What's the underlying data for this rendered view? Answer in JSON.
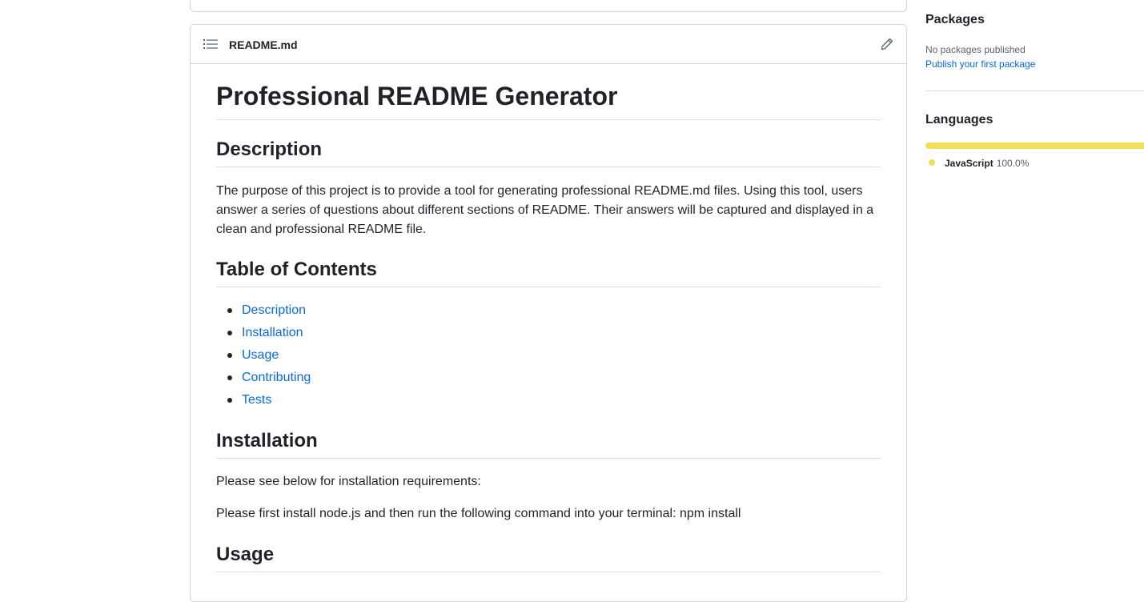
{
  "readme": {
    "filename": "README.md",
    "title": "Professional README Generator",
    "sections": {
      "description": {
        "heading": "Description",
        "body": "The purpose of this project is to provide a tool for generating professional README.md files. Using this tool, users answer a series of questions about different sections of README. Their answers will be captured and displayed in a clean and professional README file."
      },
      "toc": {
        "heading": "Table of Contents",
        "items": [
          "Description",
          "Installation",
          "Usage",
          "Contributing",
          "Tests"
        ]
      },
      "installation": {
        "heading": "Installation",
        "para1": "Please see below for installation requirements:",
        "para2": "Please first install node.js and then run the following command into your terminal: npm install"
      },
      "usage": {
        "heading": "Usage"
      }
    }
  },
  "sidebar": {
    "packages": {
      "title": "Packages",
      "empty_text": "No packages published",
      "link": "Publish your first package"
    },
    "languages": {
      "title": "Languages",
      "items": [
        {
          "name": "JavaScript",
          "percent": "100.0%",
          "fraction": 1.0,
          "color": "#f1e05a"
        }
      ]
    }
  },
  "colors": {
    "link": "#0969da",
    "border": "#d0d7de",
    "text": "#1f2328",
    "muted": "#59636e"
  },
  "icons": {
    "toc": "list-unordered-icon",
    "edit": "pencil-icon"
  }
}
